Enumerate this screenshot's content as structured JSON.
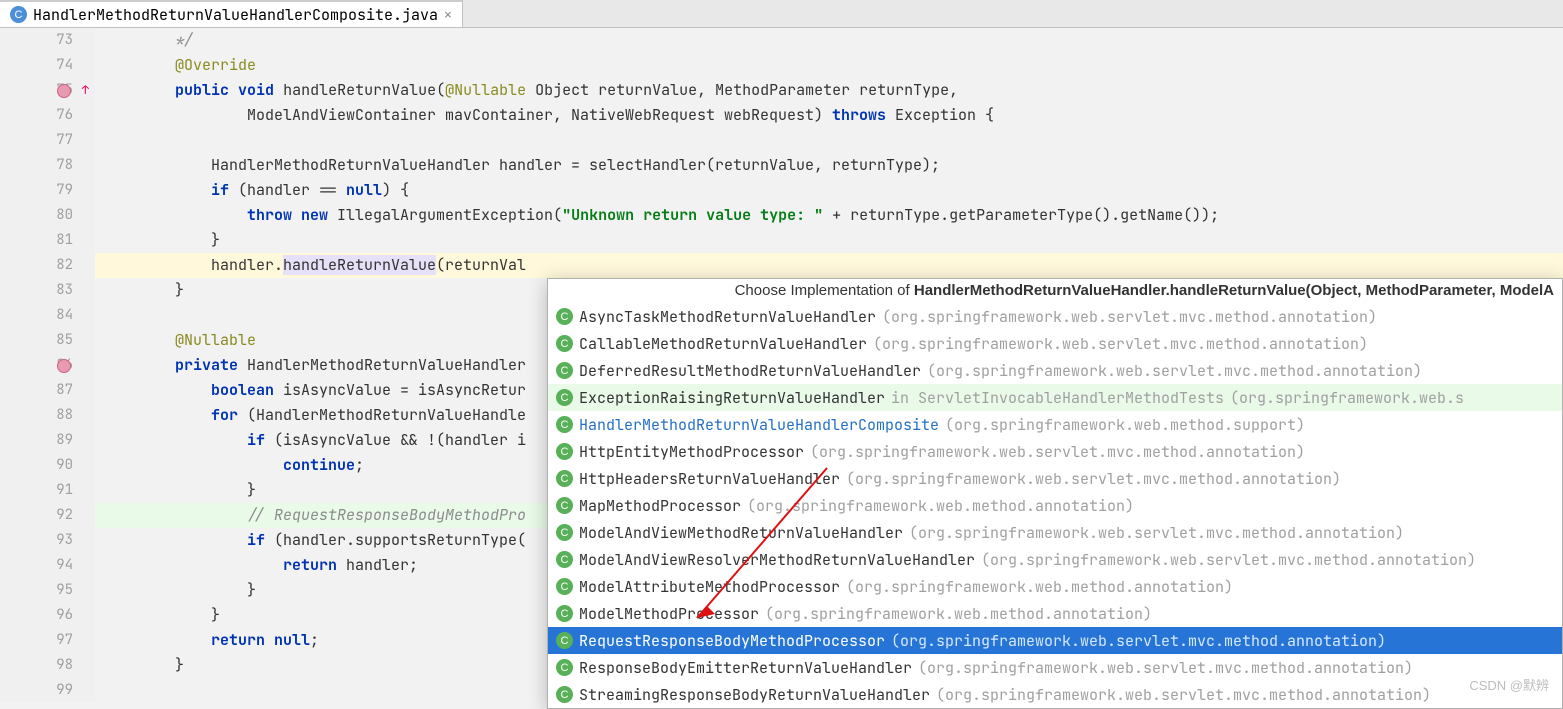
{
  "tab": {
    "filename": "HandlerMethodReturnValueHandlerComposite.java"
  },
  "gutter_start": 73,
  "gutter_end": 99,
  "code_lines": {
    "l73": "        */",
    "l74_ann": "@Override",
    "l75_kw1": "public",
    "l75_kw2": "void",
    "l75_rest": " handleReturnValue(",
    "l75_ann": "@Nullable",
    "l75_rest2": " Object returnValue, MethodParameter returnType,",
    "l76": "                ModelAndViewContainer mavContainer, NativeWebRequest webRequest) ",
    "l76_kw": "throws",
    "l76_rest": " Exception {",
    "l77": "",
    "l78": "            HandlerMethodReturnValueHandler handler = selectHandler(returnValue, returnType);",
    "l79_pre": "            ",
    "l79_kw": "if",
    "l79_rest": " (handler == ",
    "l79_kw2": "null",
    "l79_rest2": ") {",
    "l80_pre": "                ",
    "l80_kw1": "throw",
    "l80_kw2": " new",
    "l80_rest": " IllegalArgumentException(",
    "l80_str": "\"Unknown return value type: \"",
    "l80_rest2": " + returnType.getParameterType().getName());",
    "l81": "            }",
    "l82_pre": "            handler.",
    "l82_call": "handleReturnValue",
    "l82_rest": "(returnVal",
    "l83": "        }",
    "l84": "",
    "l85_ann": "@Nullable",
    "l86_kw": "private",
    "l86_rest": " HandlerMethodReturnValueHandler",
    "l87_pre": "            ",
    "l87_kw": "boolean",
    "l87_rest": " isAsyncValue = isAsyncRetur",
    "l88_pre": "            ",
    "l88_kw": "for",
    "l88_rest": " (HandlerMethodReturnValueHandle",
    "l89_pre": "                ",
    "l89_kw": "if",
    "l89_rest": " (isAsyncValue && !(handler i",
    "l90_pre": "                    ",
    "l90_kw": "continue",
    "l90_rest": ";",
    "l91": "                }",
    "l92_pre": "                ",
    "l92_comment": "// RequestResponseBodyMethodPro",
    "l93_pre": "                ",
    "l93_kw": "if",
    "l93_rest": " (handler.supportsReturnType(",
    "l94_pre": "                    ",
    "l94_kw": "return",
    "l94_rest": " handler;",
    "l95": "                }",
    "l96": "            }",
    "l97_pre": "            ",
    "l97_kw": "return",
    "l97_kw2": " null",
    "l97_rest": ";",
    "l98": "        }",
    "l99": ""
  },
  "popup": {
    "title_prefix": "Choose Implementation of ",
    "title_bold": "HandlerMethodReturnValueHandler.handleReturnValue(Object, MethodParameter, ModelA",
    "items": [
      {
        "cls": "AsyncTaskMethodReturnValueHandler",
        "pkg": "(org.springframework.web.servlet.mvc.method.annotation)",
        "green": false,
        "link": false,
        "selected": false,
        "extra": ""
      },
      {
        "cls": "CallableMethodReturnValueHandler",
        "pkg": "(org.springframework.web.servlet.mvc.method.annotation)",
        "green": false,
        "link": false,
        "selected": false,
        "extra": ""
      },
      {
        "cls": "DeferredResultMethodReturnValueHandler",
        "pkg": "(org.springframework.web.servlet.mvc.method.annotation)",
        "green": false,
        "link": false,
        "selected": false,
        "extra": ""
      },
      {
        "cls": "ExceptionRaisingReturnValueHandler",
        "pkg": "(org.springframework.web.s",
        "green": true,
        "link": false,
        "selected": false,
        "extra": " in ServletInvocableHandlerMethodTests "
      },
      {
        "cls": "HandlerMethodReturnValueHandlerComposite",
        "pkg": "(org.springframework.web.method.support)",
        "green": false,
        "link": true,
        "selected": false,
        "extra": ""
      },
      {
        "cls": "HttpEntityMethodProcessor",
        "pkg": "(org.springframework.web.servlet.mvc.method.annotation)",
        "green": false,
        "link": false,
        "selected": false,
        "extra": ""
      },
      {
        "cls": "HttpHeadersReturnValueHandler",
        "pkg": "(org.springframework.web.servlet.mvc.method.annotation)",
        "green": false,
        "link": false,
        "selected": false,
        "extra": ""
      },
      {
        "cls": "MapMethodProcessor",
        "pkg": "(org.springframework.web.method.annotation)",
        "green": false,
        "link": false,
        "selected": false,
        "extra": ""
      },
      {
        "cls": "ModelAndViewMethodReturnValueHandler",
        "pkg": "(org.springframework.web.servlet.mvc.method.annotation)",
        "green": false,
        "link": false,
        "selected": false,
        "extra": ""
      },
      {
        "cls": "ModelAndViewResolverMethodReturnValueHandler",
        "pkg": "(org.springframework.web.servlet.mvc.method.annotation)",
        "green": false,
        "link": false,
        "selected": false,
        "extra": ""
      },
      {
        "cls": "ModelAttributeMethodProcessor",
        "pkg": "(org.springframework.web.method.annotation)",
        "green": false,
        "link": false,
        "selected": false,
        "extra": ""
      },
      {
        "cls": "ModelMethodProcessor",
        "pkg": "(org.springframework.web.method.annotation)",
        "green": false,
        "link": false,
        "selected": false,
        "extra": ""
      },
      {
        "cls": "RequestResponseBodyMethodProcessor",
        "pkg": "(org.springframework.web.servlet.mvc.method.annotation)",
        "green": false,
        "link": false,
        "selected": true,
        "extra": ""
      },
      {
        "cls": "ResponseBodyEmitterReturnValueHandler",
        "pkg": "(org.springframework.web.servlet.mvc.method.annotation)",
        "green": false,
        "link": false,
        "selected": false,
        "extra": ""
      },
      {
        "cls": "StreamingResponseBodyReturnValueHandler",
        "pkg": "(org.springframework.web.servlet.mvc.method.annotation)",
        "green": false,
        "link": false,
        "selected": false,
        "extra": ""
      }
    ]
  },
  "watermark": "CSDN @默辨"
}
